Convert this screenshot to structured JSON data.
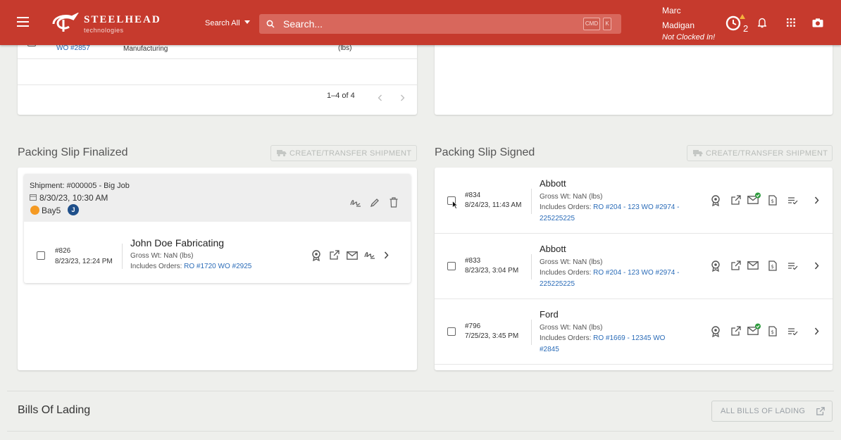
{
  "header": {
    "brand": "STEELHEAD",
    "brand_sub": "technologies",
    "search_scope": "Search All",
    "search_placeholder": "Search...",
    "kbd_cmd": "CMD",
    "kbd_k": "K",
    "user_first": "Marc",
    "user_last": "Madigan",
    "clock_status": "Not Clocked In!",
    "timer_count": "2"
  },
  "top_left_card": {
    "row": {
      "wo_link": "WO #2857",
      "process": "Manufacturing",
      "unit": "(lbs)"
    },
    "pagination": "1–4 of 4"
  },
  "finalized": {
    "title": "Packing Slip Finalized",
    "action": "CREATE/TRANSFER SHIPMENT",
    "shipment": {
      "label": "Shipment: #000005 - Big Job",
      "date": "8/30/23, 10:30 AM",
      "location": "Bay5",
      "avatar": "J"
    },
    "slips": [
      {
        "num": "#826",
        "date": "8/23/23, 12:24 PM",
        "customer": "John Doe Fabricating",
        "gross": "Gross Wt: NaN (lbs)",
        "includes": "Includes Orders:",
        "orders": "RO #1720 WO #2925"
      }
    ]
  },
  "signed": {
    "title": "Packing Slip Signed",
    "action": "CREATE/TRANSFER SHIPMENT",
    "slips": [
      {
        "num": "#834",
        "date": "8/24/23, 11:43 AM",
        "customer": "Abbott",
        "gross": "Gross Wt: NaN (lbs)",
        "includes": "Includes Orders:",
        "orders_1": "RO #204 - 123 WO #2974 -",
        "orders_2": "225225225",
        "email_sent": true
      },
      {
        "num": "#833",
        "date": "8/23/23, 3:04 PM",
        "customer": "Abbott",
        "gross": "Gross Wt: NaN (lbs)",
        "includes": "Includes Orders:",
        "orders_1": "RO #204 - 123 WO #2974 -",
        "orders_2": "225225225",
        "email_sent": false
      },
      {
        "num": "#796",
        "date": "7/25/23, 3:45 PM",
        "customer": "Ford",
        "gross": "Gross Wt: NaN (lbs)",
        "includes": "Includes Orders:",
        "orders_1": "RO #1669 - 12345 WO",
        "orders_2": "#2845",
        "email_sent": true
      }
    ]
  },
  "bills": {
    "title": "Bills Of Lading",
    "action": "ALL BILLS OF LADING"
  },
  "colors": {
    "brand_red": "#c63a2d",
    "link_blue": "#2b6cb8",
    "bay_orange": "#f59a23",
    "avatar_blue": "#1f4f8a",
    "success_green": "#2e9b3e"
  }
}
